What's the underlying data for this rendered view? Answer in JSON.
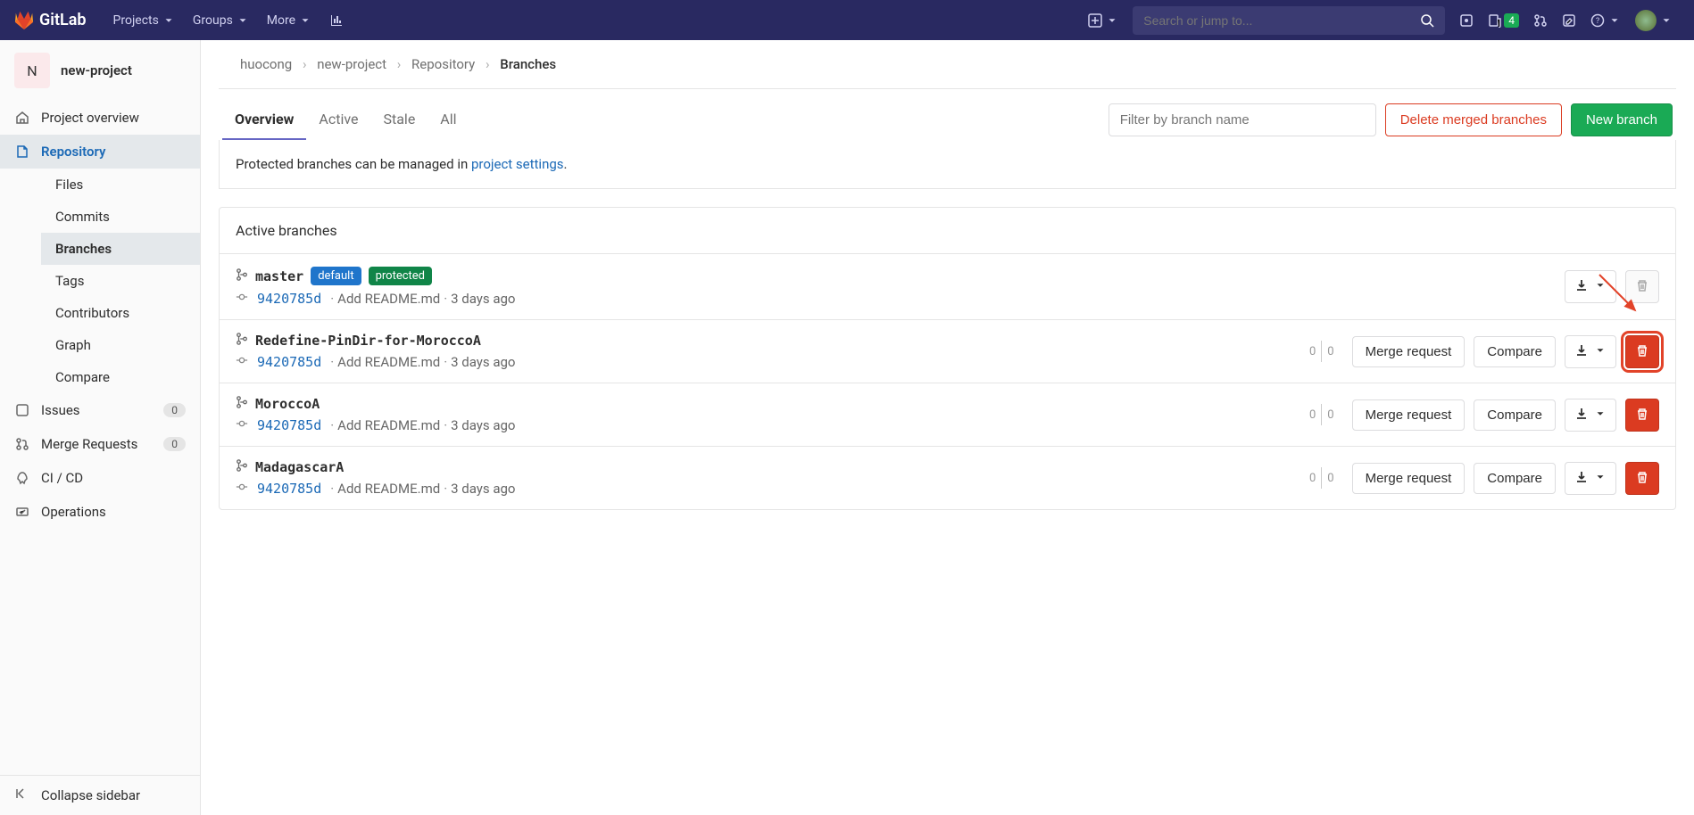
{
  "navbar": {
    "brand": "GitLab",
    "items": [
      "Projects",
      "Groups",
      "More"
    ],
    "search_placeholder": "Search or jump to...",
    "todo_count": "4"
  },
  "project": {
    "initial": "N",
    "name": "new-project"
  },
  "sidebar": {
    "overview": "Project overview",
    "repository": "Repository",
    "sub": {
      "files": "Files",
      "commits": "Commits",
      "branches": "Branches",
      "tags": "Tags",
      "contributors": "Contributors",
      "graph": "Graph",
      "compare": "Compare"
    },
    "issues": "Issues",
    "issues_count": "0",
    "merge_requests": "Merge Requests",
    "mr_count": "0",
    "cicd": "CI / CD",
    "operations": "Operations",
    "collapse": "Collapse sidebar"
  },
  "breadcrumb": {
    "user": "huocong",
    "project": "new-project",
    "repo": "Repository",
    "page": "Branches"
  },
  "tabs": {
    "overview": "Overview",
    "active": "Active",
    "stale": "Stale",
    "all": "All"
  },
  "filter_placeholder": "Filter by branch name",
  "buttons": {
    "delete_merged": "Delete merged branches",
    "new_branch": "New branch",
    "merge_request": "Merge request",
    "compare": "Compare"
  },
  "info": {
    "text": "Protected branches can be managed in ",
    "link": "project settings"
  },
  "panel_title": "Active branches",
  "badges": {
    "default": "default",
    "protected": "protected"
  },
  "branches": [
    {
      "name": "master",
      "sha": "9420785d",
      "msg": "Add README.md",
      "time": "3 days ago",
      "default": true,
      "protected": true,
      "divergence": null,
      "can_delete": false,
      "highlighted": false,
      "show_mr_compare": false
    },
    {
      "name": "Redefine-PinDir-for-MoroccoA",
      "sha": "9420785d",
      "msg": "Add README.md",
      "time": "3 days ago",
      "default": false,
      "protected": false,
      "divergence": {
        "behind": "0",
        "ahead": "0"
      },
      "can_delete": true,
      "highlighted": true,
      "show_mr_compare": true
    },
    {
      "name": "MoroccoA",
      "sha": "9420785d",
      "msg": "Add README.md",
      "time": "3 days ago",
      "default": false,
      "protected": false,
      "divergence": {
        "behind": "0",
        "ahead": "0"
      },
      "can_delete": true,
      "highlighted": false,
      "show_mr_compare": true
    },
    {
      "name": "MadagascarA",
      "sha": "9420785d",
      "msg": "Add README.md",
      "time": "3 days ago",
      "default": false,
      "protected": false,
      "divergence": {
        "behind": "0",
        "ahead": "0"
      },
      "can_delete": true,
      "highlighted": false,
      "show_mr_compare": true
    }
  ]
}
